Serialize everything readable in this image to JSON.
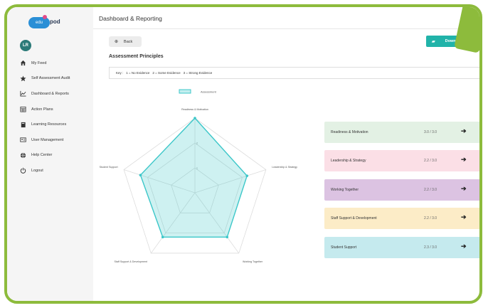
{
  "brand": {
    "logo_left": "edu",
    "logo_right": "pod"
  },
  "user": {
    "initials": "LR"
  },
  "sidebar": {
    "items": [
      {
        "label": "My Feed",
        "icon": "home-icon"
      },
      {
        "label": "Self Assessment Audit",
        "icon": "star-icon"
      },
      {
        "label": "Dashboard & Reports",
        "icon": "chart-line-icon"
      },
      {
        "label": "Action Plans",
        "icon": "calendar-grid-icon"
      },
      {
        "label": "Learning Resources",
        "icon": "book-icon"
      },
      {
        "label": "User Management",
        "icon": "id-card-icon"
      },
      {
        "label": "Help Center",
        "icon": "globe-icon"
      },
      {
        "label": "Logout",
        "icon": "power-icon"
      }
    ]
  },
  "header": {
    "title": "Dashboard & Reporting"
  },
  "toolbar": {
    "back_label": "Back",
    "download_label": "Download Reports"
  },
  "section": {
    "title": "Assessment Principles"
  },
  "key": {
    "prefix": "Key :",
    "items": [
      "1 = No Evidence",
      "2 = Some Evidence",
      "3 = Strong Evidence"
    ]
  },
  "chart_data": {
    "type": "radar",
    "legend": "Assessment",
    "axes": [
      "Readiness & Motivation",
      "Leadership & Strategy",
      "Working Together",
      "Staff Support & Development",
      "Student Support"
    ],
    "series": [
      {
        "name": "Assessment",
        "values": [
          3.0,
          2.2,
          2.2,
          2.2,
          2.3
        ]
      }
    ],
    "rmax": 3,
    "tick_labels": [
      "1",
      "2"
    ],
    "colors": {
      "line": "#3cc7c9",
      "fill": "#3cc7c9",
      "grid": "#dcdcdc"
    }
  },
  "cards": [
    {
      "label": "Readiness & Motivation",
      "score": "3.0 / 3.0",
      "bg": "#e3f1e4"
    },
    {
      "label": "Leadership & Strategy",
      "score": "2.2 / 3.0",
      "bg": "#fbdfe6"
    },
    {
      "label": "Working Together",
      "score": "2.2 / 3.0",
      "bg": "#dcc3e2"
    },
    {
      "label": "Staff Support & Development",
      "score": "2.2 / 3.0",
      "bg": "#fcecc7"
    },
    {
      "label": "Student Support",
      "score": "2.3 / 3.0",
      "bg": "#c5eaee"
    }
  ],
  "colors": {
    "frame": "#8dbb3c",
    "accent": "#21b3a9",
    "avatar": "#2b7a78"
  }
}
